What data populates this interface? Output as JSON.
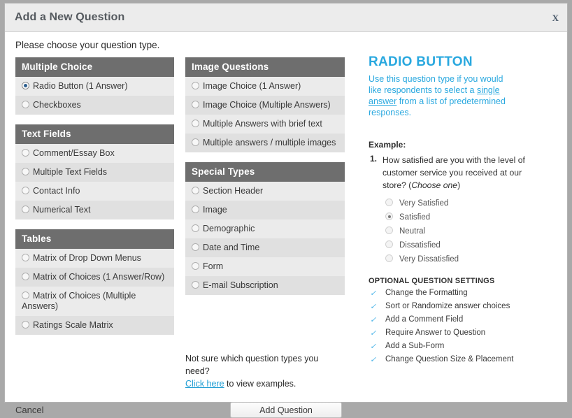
{
  "window": {
    "title": "Add a New Question",
    "close_label": "X",
    "instruction": "Please choose your question type."
  },
  "columns": {
    "left": [
      {
        "header": "Multiple Choice",
        "options": [
          {
            "label": "Radio Button (1 Answer)",
            "selected": true
          },
          {
            "label": "Checkboxes",
            "selected": false
          }
        ]
      },
      {
        "header": "Text Fields",
        "options": [
          {
            "label": "Comment/Essay Box",
            "selected": false
          },
          {
            "label": "Multiple Text Fields",
            "selected": false
          },
          {
            "label": "Contact Info",
            "selected": false
          },
          {
            "label": "Numerical Text",
            "selected": false
          }
        ]
      },
      {
        "header": "Tables",
        "options": [
          {
            "label": "Matrix of Drop Down Menus",
            "selected": false
          },
          {
            "label": "Matrix of Choices (1 Answer/Row)",
            "selected": false
          },
          {
            "label": "Matrix of Choices (Multiple Answers)",
            "selected": false
          },
          {
            "label": "Ratings Scale Matrix",
            "selected": false
          }
        ]
      }
    ],
    "middle": [
      {
        "header": "Image Questions",
        "options": [
          {
            "label": "Image Choice (1 Answer)",
            "selected": false
          },
          {
            "label": "Image Choice (Multiple Answers)",
            "selected": false
          },
          {
            "label": "Multiple Answers with brief text",
            "selected": false
          },
          {
            "label": "Multiple answers / multiple images",
            "selected": false
          }
        ]
      },
      {
        "header": "Special Types",
        "options": [
          {
            "label": "Section Header",
            "selected": false
          },
          {
            "label": "Image",
            "selected": false
          },
          {
            "label": "Demographic",
            "selected": false
          },
          {
            "label": "Date and Time",
            "selected": false
          },
          {
            "label": "Form",
            "selected": false
          },
          {
            "label": "E-mail Subscription",
            "selected": false
          }
        ]
      }
    ]
  },
  "info_panel": {
    "title": "RADIO BUTTON",
    "description_part1": "Use this question type if you would like respondents to select a ",
    "description_link": "single answer",
    "description_part2": " from a list of predetermined responses.",
    "example_label": "Example:",
    "question_number": "1.",
    "question_text": "How satisfied are you with the level of customer service you received at our store? (",
    "question_hint": "Choose one",
    "question_text_end": ")",
    "choices": [
      {
        "label": "Very Satisfied",
        "selected": false
      },
      {
        "label": "Satisfied",
        "selected": true
      },
      {
        "label": "Neutral",
        "selected": false
      },
      {
        "label": "Dissatisfied",
        "selected": false
      },
      {
        "label": "Very Dissatisfied",
        "selected": false
      }
    ],
    "settings_title": "OPTIONAL QUESTION SETTINGS",
    "settings": [
      "Change the Formatting",
      "Sort or Randomize answer choices",
      "Add a Comment Field",
      "Require Answer to Question",
      "Add a Sub-Form",
      "Change Question Size & Placement"
    ]
  },
  "helper": {
    "line1": "Not sure which question types you need?",
    "link": "Click here",
    "line2": " to view examples."
  },
  "footer": {
    "cancel_label": "Cancel",
    "submit_label": "Add Question"
  },
  "colors": {
    "accent": "#29a8df",
    "header_bar": "#6e6e6e",
    "row_light": "#ebebeb",
    "row_dark": "#e0e0e0",
    "link": "#1d9cd3",
    "check": "#49b3e8"
  }
}
